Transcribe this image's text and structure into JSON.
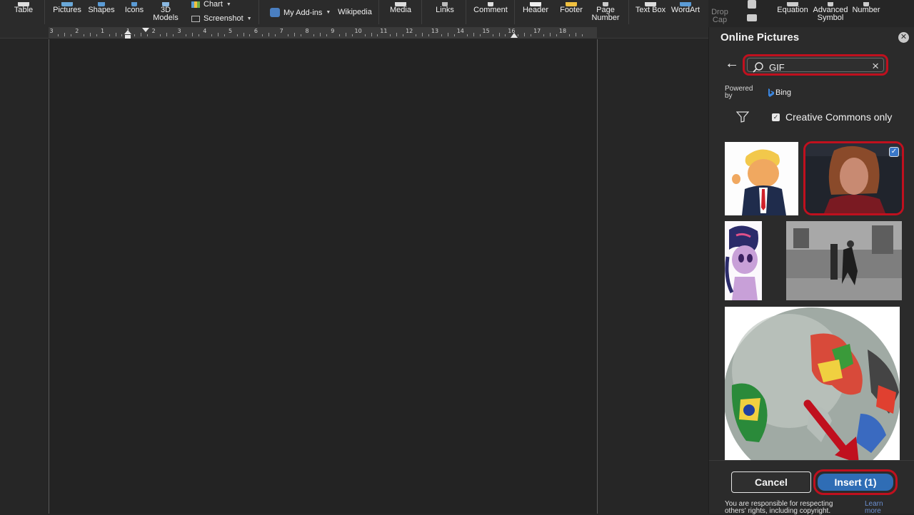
{
  "ribbon": {
    "table": "Table",
    "pictures": "Pictures",
    "shapes": "Shapes",
    "icons": "Icons",
    "models3d": [
      "3D",
      "Models"
    ],
    "chart": "Chart",
    "screenshot": "Screenshot",
    "my_addins": "My Add-ins",
    "wikipedia": "Wikipedia",
    "media": "Media",
    "links": "Links",
    "comment": "Comment",
    "header": "Header",
    "footer": "Footer",
    "page_number": [
      "Page",
      "Number"
    ],
    "text_box": "Text Box",
    "wordart": "WordArt",
    "drop_cap": [
      "Drop",
      "Cap"
    ],
    "equation": "Equation",
    "advanced_symbol": [
      "Advanced",
      "Symbol"
    ],
    "number": "Number"
  },
  "ruler": {
    "labels": [
      "3",
      "2",
      "1",
      "1",
      "2",
      "3",
      "4",
      "5",
      "6",
      "7",
      "8",
      "9",
      "10",
      "11",
      "12",
      "13",
      "14",
      "15",
      "16",
      "17",
      "18"
    ]
  },
  "pane": {
    "title": "Online Pictures",
    "search_value": "GIF",
    "powered_by": "Powered by",
    "bing": "Bing",
    "creative_commons": "Creative Commons only",
    "creative_commons_checked": true,
    "selected_image_index": 1,
    "cancel": "Cancel",
    "insert": "Insert (1)",
    "disclaimer": "You are responsible for respecting others' rights, including copyright.",
    "learn_more": "Learn more"
  },
  "colors": {
    "annotation_red": "#c0101e",
    "insert_blue": "#2f6db5",
    "pane_bg": "#2b2b2b"
  }
}
